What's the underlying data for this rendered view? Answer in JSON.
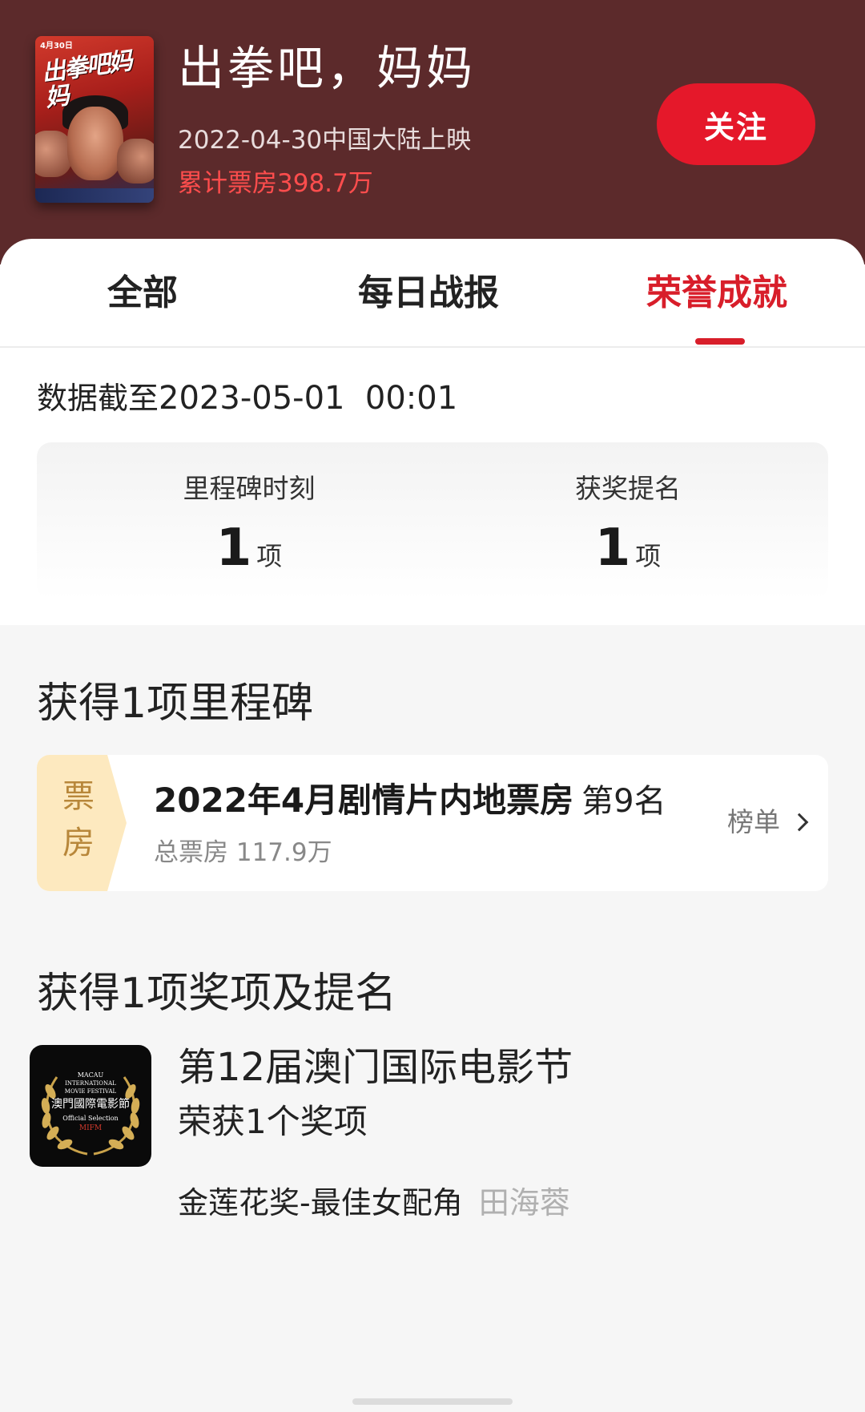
{
  "header": {
    "poster": {
      "date": "4月30日",
      "title": "出拳吧妈妈"
    },
    "title": "出拳吧，妈妈",
    "release": "2022-04-30中国大陆上映",
    "boxoffice": "累计票房398.7万",
    "follow_label": "关注"
  },
  "tabs": [
    {
      "label": "全部",
      "active": false
    },
    {
      "label": "每日战报",
      "active": false
    },
    {
      "label": "荣誉成就",
      "active": true
    }
  ],
  "summary": {
    "cutoff_label": "数据截至",
    "cutoff_time": "2023-05-01  00:01",
    "stats": [
      {
        "label": "里程碑时刻",
        "value": "1",
        "unit": "项"
      },
      {
        "label": "获奖提名",
        "value": "1",
        "unit": "项"
      }
    ]
  },
  "milestones": {
    "heading": "获得1项里程碑",
    "items": [
      {
        "badge": [
          "票",
          "房"
        ],
        "title": "2022年4月剧情片内地票房",
        "rank": "第9名",
        "subtitle": "总票房 117.9万",
        "link": "榜单"
      }
    ]
  },
  "awards": {
    "heading": "获得1项奖项及提名",
    "items": [
      {
        "logo_lines": [
          "MACAU",
          "INTERNATIONAL",
          "MOVIE FESTIVAL",
          "澳門國際電影節",
          "Official Selection",
          "MIFM"
        ],
        "festival": "第12届澳门国际电影节",
        "count": "荣获1个奖项",
        "award": "金莲花奖-最佳女配角",
        "person": "田海蓉"
      }
    ]
  },
  "colors": {
    "header_bg": "#5c2a2b",
    "accent_red": "#e5182a",
    "tab_active": "#d81e2a",
    "boxoffice_text": "#ff4d4d",
    "badge_bg": "#fde9bf",
    "badge_text": "#b8873a"
  }
}
